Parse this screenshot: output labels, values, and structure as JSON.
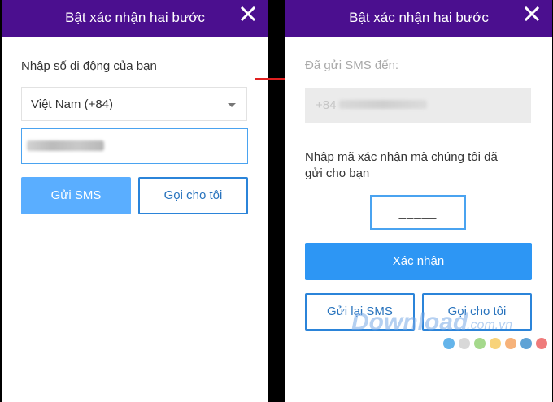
{
  "left_dialog": {
    "title": "Bật xác nhận hai bước",
    "prompt": "Nhập số di động của bạn",
    "country_value": "Việt Nam (+84)",
    "send_sms_label": "Gửi SMS",
    "call_me_label": "Gọi cho tôi"
  },
  "right_dialog": {
    "title": "Bật xác nhận hai bước",
    "sent_to_label": "Đã gửi SMS đến:",
    "phone_prefix": "+84",
    "code_prompt_line1": "Nhập mã xác nhận mà chúng tôi đã",
    "code_prompt_line2": "gửi cho bạn",
    "code_placeholder": "_____",
    "confirm_label": "Xác nhận",
    "resend_sms_label": "Gửi lại SMS",
    "call_me_label": "Gọi cho tôi"
  },
  "watermark": {
    "text": "Download",
    "domain": ".com.vn",
    "dot_colors": [
      "#64b4ea",
      "#d8d8d8",
      "#a5d98c",
      "#f8d37a",
      "#f6b27a",
      "#5fa3d6",
      "#ef7b7b"
    ]
  },
  "colors": {
    "header": "#4b0f8f",
    "primary_button": "#5aaeff",
    "confirm_button": "#2d96f4",
    "arrow": "#e02020"
  },
  "icons": {
    "close": "close-icon",
    "arrow": "arrow-right-icon",
    "dropdown": "chevron-down-icon"
  }
}
